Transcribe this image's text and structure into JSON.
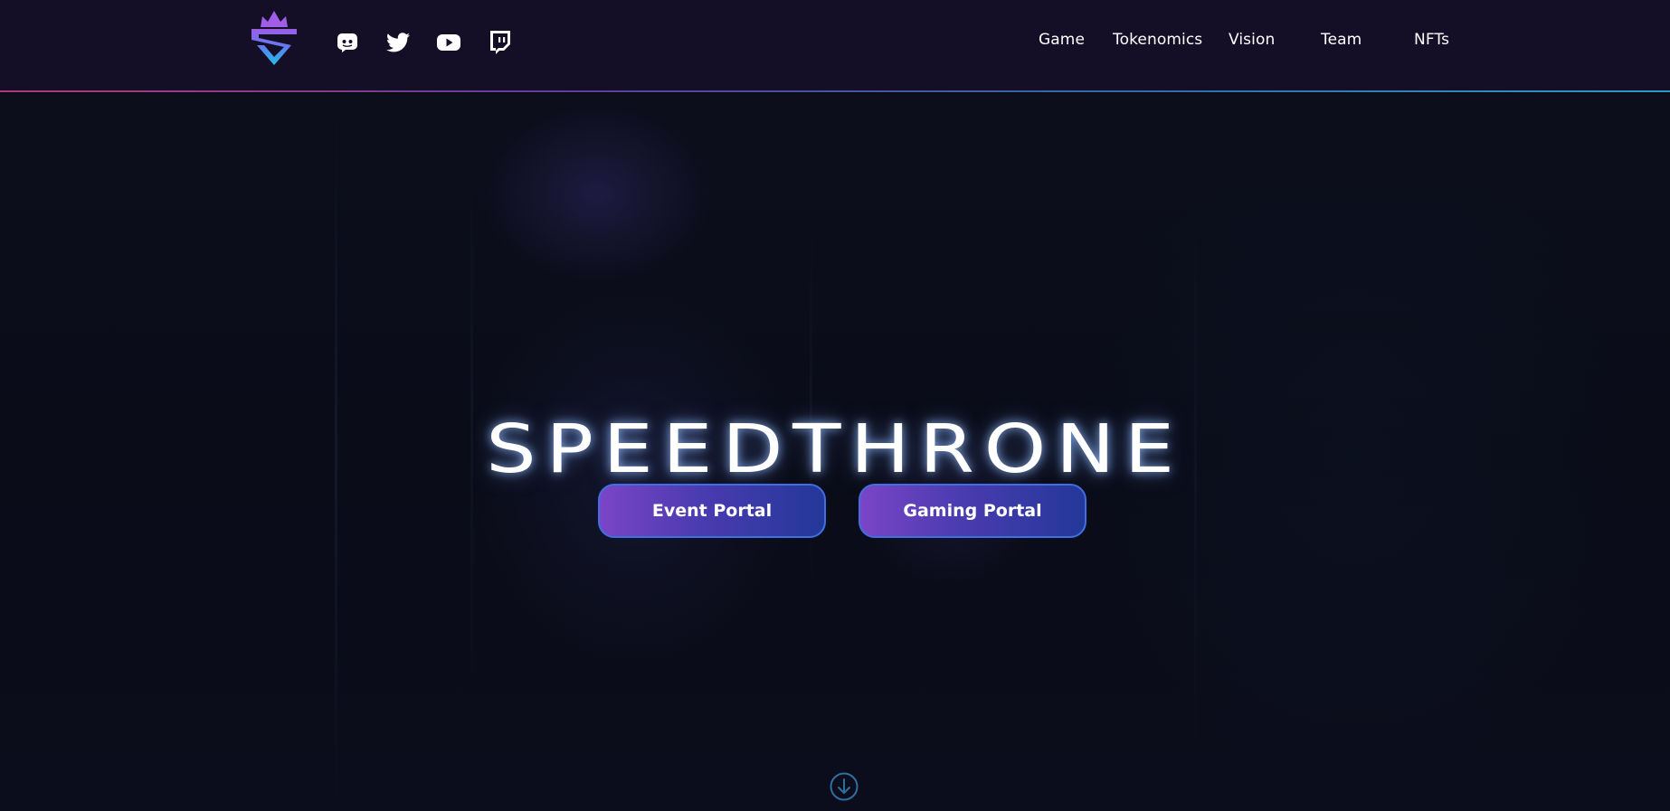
{
  "header": {
    "logo_icon": "speedthrone-crown-shield-logo",
    "social": [
      {
        "icon": "discord-icon"
      },
      {
        "icon": "twitter-icon"
      },
      {
        "icon": "youtube-icon"
      },
      {
        "icon": "twitch-icon"
      }
    ],
    "nav": [
      {
        "label": "Game"
      },
      {
        "label": "Tokenomics"
      },
      {
        "label": "Vision"
      },
      {
        "label": "Team"
      },
      {
        "label": "NFTs"
      }
    ],
    "colors": {
      "background": "#140f27",
      "divider_start": "#b03a7a",
      "divider_end": "#2d9bc6"
    }
  },
  "hero": {
    "title": "SPEEDTHRONE",
    "buttons": [
      {
        "label": "Event Portal"
      },
      {
        "label": "Gaming Portal"
      }
    ],
    "scroll_icon": "arrow-down-circle-icon",
    "colors": {
      "button_gradient_start": "#7a45c6",
      "button_gradient_end": "#23389a",
      "button_border": "#3f6fe0",
      "scroll_icon": "#2e6f9e"
    }
  }
}
